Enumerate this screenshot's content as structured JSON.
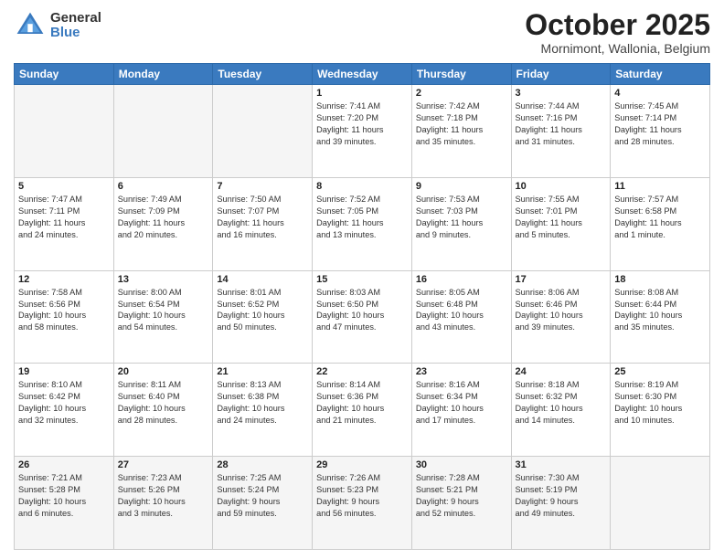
{
  "header": {
    "logo_general": "General",
    "logo_blue": "Blue",
    "month_title": "October 2025",
    "subtitle": "Mornimont, Wallonia, Belgium"
  },
  "days_of_week": [
    "Sunday",
    "Monday",
    "Tuesday",
    "Wednesday",
    "Thursday",
    "Friday",
    "Saturday"
  ],
  "weeks": [
    [
      {
        "day": "",
        "info": []
      },
      {
        "day": "",
        "info": []
      },
      {
        "day": "",
        "info": []
      },
      {
        "day": "1",
        "info": [
          "Sunrise: 7:41 AM",
          "Sunset: 7:20 PM",
          "Daylight: 11 hours",
          "and 39 minutes."
        ]
      },
      {
        "day": "2",
        "info": [
          "Sunrise: 7:42 AM",
          "Sunset: 7:18 PM",
          "Daylight: 11 hours",
          "and 35 minutes."
        ]
      },
      {
        "day": "3",
        "info": [
          "Sunrise: 7:44 AM",
          "Sunset: 7:16 PM",
          "Daylight: 11 hours",
          "and 31 minutes."
        ]
      },
      {
        "day": "4",
        "info": [
          "Sunrise: 7:45 AM",
          "Sunset: 7:14 PM",
          "Daylight: 11 hours",
          "and 28 minutes."
        ]
      }
    ],
    [
      {
        "day": "5",
        "info": [
          "Sunrise: 7:47 AM",
          "Sunset: 7:11 PM",
          "Daylight: 11 hours",
          "and 24 minutes."
        ]
      },
      {
        "day": "6",
        "info": [
          "Sunrise: 7:49 AM",
          "Sunset: 7:09 PM",
          "Daylight: 11 hours",
          "and 20 minutes."
        ]
      },
      {
        "day": "7",
        "info": [
          "Sunrise: 7:50 AM",
          "Sunset: 7:07 PM",
          "Daylight: 11 hours",
          "and 16 minutes."
        ]
      },
      {
        "day": "8",
        "info": [
          "Sunrise: 7:52 AM",
          "Sunset: 7:05 PM",
          "Daylight: 11 hours",
          "and 13 minutes."
        ]
      },
      {
        "day": "9",
        "info": [
          "Sunrise: 7:53 AM",
          "Sunset: 7:03 PM",
          "Daylight: 11 hours",
          "and 9 minutes."
        ]
      },
      {
        "day": "10",
        "info": [
          "Sunrise: 7:55 AM",
          "Sunset: 7:01 PM",
          "Daylight: 11 hours",
          "and 5 minutes."
        ]
      },
      {
        "day": "11",
        "info": [
          "Sunrise: 7:57 AM",
          "Sunset: 6:58 PM",
          "Daylight: 11 hours",
          "and 1 minute."
        ]
      }
    ],
    [
      {
        "day": "12",
        "info": [
          "Sunrise: 7:58 AM",
          "Sunset: 6:56 PM",
          "Daylight: 10 hours",
          "and 58 minutes."
        ]
      },
      {
        "day": "13",
        "info": [
          "Sunrise: 8:00 AM",
          "Sunset: 6:54 PM",
          "Daylight: 10 hours",
          "and 54 minutes."
        ]
      },
      {
        "day": "14",
        "info": [
          "Sunrise: 8:01 AM",
          "Sunset: 6:52 PM",
          "Daylight: 10 hours",
          "and 50 minutes."
        ]
      },
      {
        "day": "15",
        "info": [
          "Sunrise: 8:03 AM",
          "Sunset: 6:50 PM",
          "Daylight: 10 hours",
          "and 47 minutes."
        ]
      },
      {
        "day": "16",
        "info": [
          "Sunrise: 8:05 AM",
          "Sunset: 6:48 PM",
          "Daylight: 10 hours",
          "and 43 minutes."
        ]
      },
      {
        "day": "17",
        "info": [
          "Sunrise: 8:06 AM",
          "Sunset: 6:46 PM",
          "Daylight: 10 hours",
          "and 39 minutes."
        ]
      },
      {
        "day": "18",
        "info": [
          "Sunrise: 8:08 AM",
          "Sunset: 6:44 PM",
          "Daylight: 10 hours",
          "and 35 minutes."
        ]
      }
    ],
    [
      {
        "day": "19",
        "info": [
          "Sunrise: 8:10 AM",
          "Sunset: 6:42 PM",
          "Daylight: 10 hours",
          "and 32 minutes."
        ]
      },
      {
        "day": "20",
        "info": [
          "Sunrise: 8:11 AM",
          "Sunset: 6:40 PM",
          "Daylight: 10 hours",
          "and 28 minutes."
        ]
      },
      {
        "day": "21",
        "info": [
          "Sunrise: 8:13 AM",
          "Sunset: 6:38 PM",
          "Daylight: 10 hours",
          "and 24 minutes."
        ]
      },
      {
        "day": "22",
        "info": [
          "Sunrise: 8:14 AM",
          "Sunset: 6:36 PM",
          "Daylight: 10 hours",
          "and 21 minutes."
        ]
      },
      {
        "day": "23",
        "info": [
          "Sunrise: 8:16 AM",
          "Sunset: 6:34 PM",
          "Daylight: 10 hours",
          "and 17 minutes."
        ]
      },
      {
        "day": "24",
        "info": [
          "Sunrise: 8:18 AM",
          "Sunset: 6:32 PM",
          "Daylight: 10 hours",
          "and 14 minutes."
        ]
      },
      {
        "day": "25",
        "info": [
          "Sunrise: 8:19 AM",
          "Sunset: 6:30 PM",
          "Daylight: 10 hours",
          "and 10 minutes."
        ]
      }
    ],
    [
      {
        "day": "26",
        "info": [
          "Sunrise: 7:21 AM",
          "Sunset: 5:28 PM",
          "Daylight: 10 hours",
          "and 6 minutes."
        ]
      },
      {
        "day": "27",
        "info": [
          "Sunrise: 7:23 AM",
          "Sunset: 5:26 PM",
          "Daylight: 10 hours",
          "and 3 minutes."
        ]
      },
      {
        "day": "28",
        "info": [
          "Sunrise: 7:25 AM",
          "Sunset: 5:24 PM",
          "Daylight: 9 hours",
          "and 59 minutes."
        ]
      },
      {
        "day": "29",
        "info": [
          "Sunrise: 7:26 AM",
          "Sunset: 5:23 PM",
          "Daylight: 9 hours",
          "and 56 minutes."
        ]
      },
      {
        "day": "30",
        "info": [
          "Sunrise: 7:28 AM",
          "Sunset: 5:21 PM",
          "Daylight: 9 hours",
          "and 52 minutes."
        ]
      },
      {
        "day": "31",
        "info": [
          "Sunrise: 7:30 AM",
          "Sunset: 5:19 PM",
          "Daylight: 9 hours",
          "and 49 minutes."
        ]
      },
      {
        "day": "",
        "info": []
      }
    ]
  ]
}
